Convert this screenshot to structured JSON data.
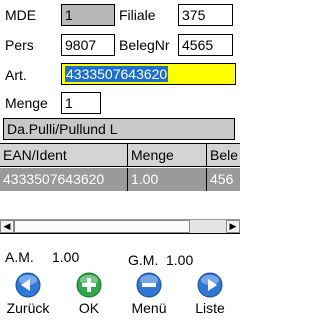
{
  "form": {
    "mde_label": "MDE",
    "mde_value": "1",
    "filiale_label": "Filiale",
    "filiale_value": "375",
    "pers_label": "Pers",
    "pers_value": "9807",
    "belegnr_label": "BelegNr",
    "belegnr_value": "4565",
    "art_label": "Art.",
    "art_value": "4333507643620",
    "menge_label": "Menge",
    "menge_value": "1",
    "description": "Da.Pulli/Pullund L"
  },
  "table": {
    "headers": [
      "EAN/Ident",
      "Menge",
      "Bele"
    ],
    "rows": [
      [
        "4333507643620",
        "1.00",
        "456"
      ]
    ]
  },
  "totals": {
    "am_label": "A.M.",
    "am_value": "1.00",
    "gm_label": "G.M.",
    "gm_value": "1.00"
  },
  "buttons": [
    {
      "label": "Zurück",
      "icon": "arrow-left-icon"
    },
    {
      "label": "OK",
      "icon": "plus-icon"
    },
    {
      "label": "Menü",
      "icon": "menu-minus-icon"
    },
    {
      "label": "Liste",
      "icon": "arrow-right-icon"
    }
  ],
  "colors": {
    "active_field": "#ffff00",
    "readonly_field": "#b8b8b8",
    "selected_row": "#9a9a9a",
    "button_blue": "#2f78d8",
    "button_green": "#2fa84a"
  }
}
